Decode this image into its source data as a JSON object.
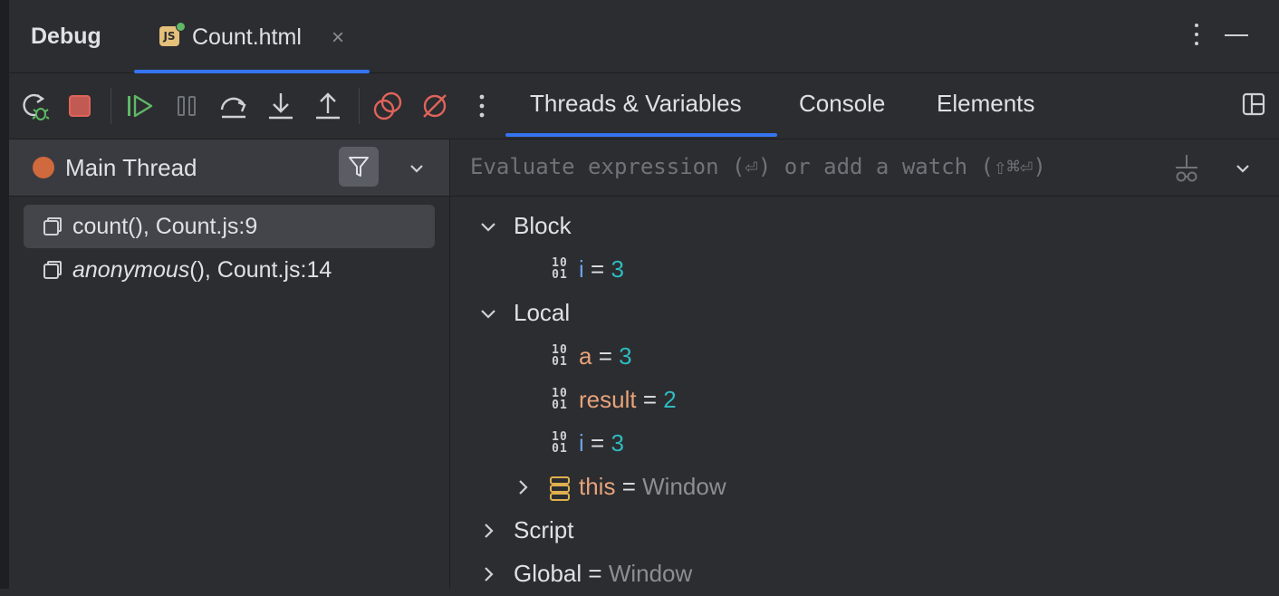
{
  "header": {
    "title": "Debug",
    "file_tab": {
      "icon_text": "JS",
      "label": "Count.html",
      "close": "×"
    }
  },
  "toolbar": {
    "icons": [
      "rerun-icon",
      "stop-icon",
      "resume-icon",
      "pause-icon",
      "step-over-icon",
      "step-into-icon",
      "step-out-icon",
      "view-breakpoints-icon",
      "mute-breakpoints-icon",
      "more-icon"
    ],
    "tabs": [
      {
        "label": "Threads & Variables",
        "active": true
      },
      {
        "label": "Console",
        "active": false
      },
      {
        "label": "Elements",
        "active": false
      }
    ]
  },
  "threads": {
    "current": "Main Thread",
    "frames": [
      {
        "name": "count",
        "suffix": "(), Count.js:9",
        "italic": false,
        "selected": true
      },
      {
        "name": "anonymous",
        "suffix": "(), Count.js:14",
        "italic": true,
        "selected": false
      }
    ]
  },
  "evaluate": {
    "placeholder": "Evaluate expression (⏎) or add a watch (⇧⌘⏎)"
  },
  "variables": {
    "primitive_icon": [
      "10",
      "01"
    ],
    "equals": "=",
    "block": {
      "label": "Block",
      "vars": [
        {
          "name": "i",
          "value": "3"
        }
      ]
    },
    "local": {
      "label": "Local",
      "vars": [
        {
          "name": "a",
          "value": "3"
        },
        {
          "name": "result",
          "value": "2"
        },
        {
          "name": "i",
          "value": "3"
        }
      ],
      "this": {
        "name": "this",
        "value": "Window"
      }
    },
    "script": {
      "label": "Script"
    },
    "global": {
      "label": "Global",
      "value": "Window"
    }
  },
  "colors": {
    "accent": "#3574f0",
    "thread_dot": "#d0693d",
    "stop_red": "#e0635a",
    "resume_green": "#5fb865",
    "local_name": "#e8a27a",
    "block_name": "#6fa1e8",
    "number": "#2fbac0"
  }
}
